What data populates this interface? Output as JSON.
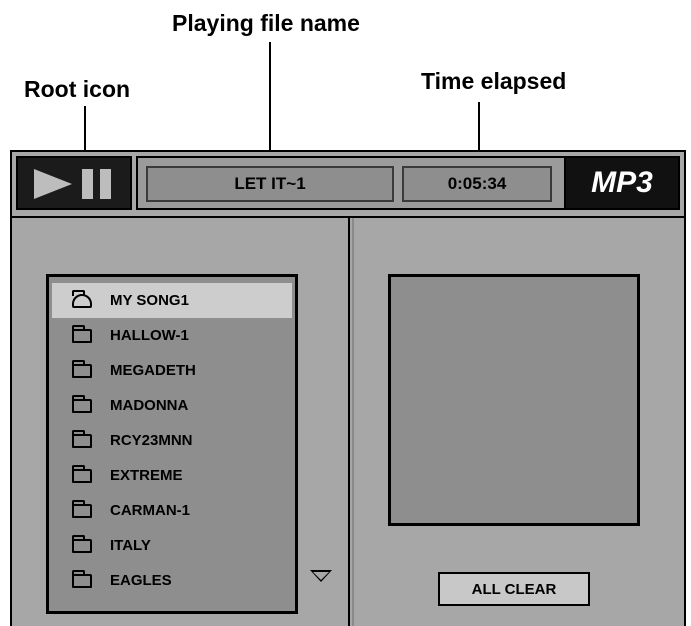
{
  "callouts": {
    "playing_file_name": "Playing file name",
    "root_icon": "Root icon",
    "time_elapsed": "Time elapsed"
  },
  "player": {
    "current_file": "LET IT~1",
    "elapsed_time": "0:05:34",
    "logo": "MP3"
  },
  "folder_list": [
    {
      "label": "MY SONG1",
      "icon": "root-icon",
      "selected": true
    },
    {
      "label": "HALLOW-1",
      "icon": "folder-icon"
    },
    {
      "label": "MEGADETH",
      "icon": "folder-icon"
    },
    {
      "label": "MADONNA",
      "icon": "folder-icon"
    },
    {
      "label": "RCY23MNN",
      "icon": "folder-icon"
    },
    {
      "label": "EXTREME",
      "icon": "folder-icon"
    },
    {
      "label": "CARMAN-1",
      "icon": "folder-icon"
    },
    {
      "label": "ITALY",
      "icon": "folder-icon"
    },
    {
      "label": "EAGLES",
      "icon": "folder-icon"
    }
  ],
  "buttons": {
    "all_clear": "ALL CLEAR"
  }
}
